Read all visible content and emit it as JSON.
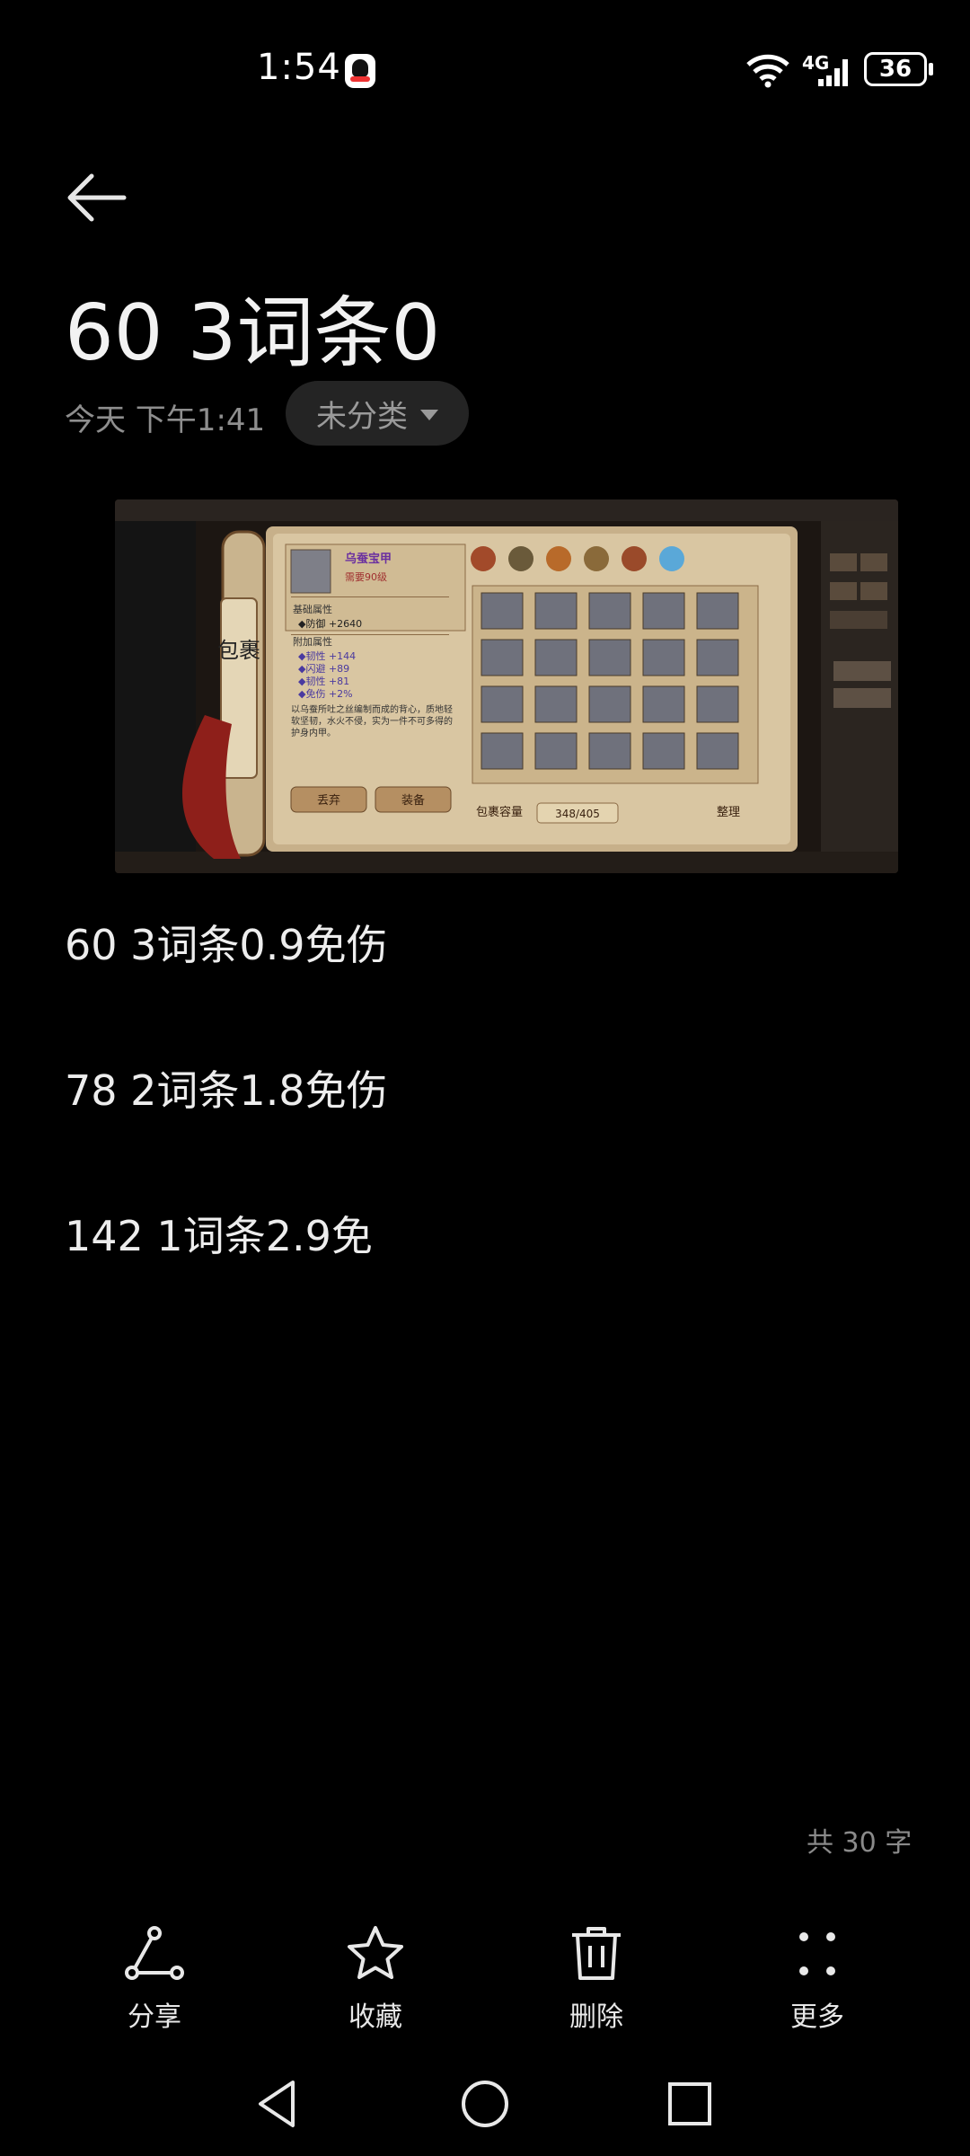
{
  "status_bar": {
    "time": "1:54",
    "network": "4G",
    "battery": "36"
  },
  "note": {
    "title": "60 3词条0",
    "date": "今天 下午1:41",
    "category": "未分类",
    "lines": [
      "60 3词条0.9免伤",
      "78 2词条1.8免伤",
      "142 1词条2.9免"
    ],
    "word_count": "共 30 字"
  },
  "game_image": {
    "item_name": "乌蚕宝甲",
    "item_req": "需要90级",
    "base_attr_title": "基础属性",
    "defense": "◆防御 +2640",
    "extra_attr_title": "附加属性",
    "attrs": [
      "◆韧性 +144",
      "◆闪避 +89",
      "◆韧性 +81",
      "◆免伤 +2%"
    ],
    "desc": "以乌蚕所吐之丝编制而成的背心，质地轻软坚韧，水火不侵，实为一件不可多得的护身内甲。",
    "discard_label": "丢弃",
    "equip_label": "装备",
    "capacity_label": "包裹容量",
    "capacity_value": "348/405",
    "sort_label": "整理",
    "scroll_chars": "包裹"
  },
  "toolbar": {
    "share": "分享",
    "favorite": "收藏",
    "delete": "删除",
    "more": "更多"
  }
}
